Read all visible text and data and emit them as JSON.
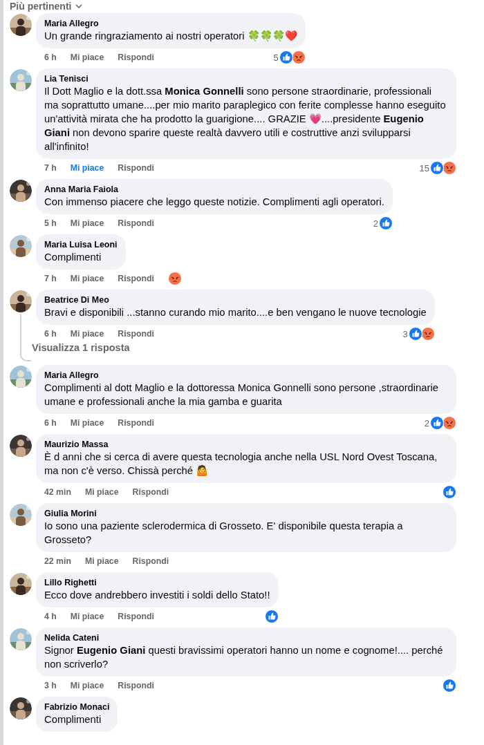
{
  "sort_menu": {
    "label": "Più pertinenti"
  },
  "comments": [
    {
      "author": "Maria Allegro",
      "text": "Un grande ringraziamento ai nostri operatori 🍀🍀🍀❤️",
      "time": "6 h",
      "like_label": "Mi piace",
      "liked": false,
      "reply_label": "Rispondi",
      "reactions": {
        "count": "5",
        "like": true,
        "angry": true
      }
    },
    {
      "author": "Lia Tenisci",
      "text": "Il Dott Maglio e la dott.ssa **Monica Gonnelli** sono persone straordinarie, professionali ma soprattutto umane....per mio marito paraplegico con ferite complesse hanno eseguito un'attività mirata che ha prodotto la guarigione.... GRAZIE 💗....presidente **Eugenio Giani** non devono sparire queste realtà davvero utili e costruttive anzi svilupparsi all'infinito!",
      "time": "7 h",
      "like_label": "Mi piace",
      "liked": true,
      "reply_label": "Rispondi",
      "reactions": {
        "count": "15",
        "like": true,
        "angry": true
      }
    },
    {
      "author": "Anna Maria Faiola",
      "text": "Con immenso piacere che leggo queste notizie. Complimenti agli operatori.",
      "time": "5 h",
      "like_label": "Mi piace",
      "liked": false,
      "reply_label": "Rispondi",
      "reactions": {
        "count": "2",
        "like": true,
        "angry": false
      }
    },
    {
      "author": "Maria Luisa Leoni",
      "text": "Complimenti",
      "time": "7 h",
      "like_label": "Mi piace",
      "liked": false,
      "reply_label": "Rispondi",
      "reactions": {
        "like": false,
        "angry": true
      }
    },
    {
      "author": "Beatrice Di Meo",
      "text": "Bravi e disponibili ...stanno curando mio marito....e ben vengano le nuove tecnologie",
      "time": "6 h",
      "like_label": "Mi piace",
      "liked": false,
      "reply_label": "Rispondi",
      "reactions": {
        "count": "3",
        "like": true,
        "angry": true
      },
      "replies_link": "Visualizza 1 risposta"
    },
    {
      "author": "Maria Allegro",
      "text": "Complimenti al dott Maglio e la dottoressa Monica Gonnelli sono persone ,straordinarie umane e professionali anche la mia gamba e guarita",
      "time": "6 h",
      "like_label": "Mi piace",
      "liked": false,
      "reply_label": "Rispondi",
      "reactions": {
        "count": "2",
        "like": true,
        "angry": true
      }
    },
    {
      "author": "Maurizio Massa",
      "text": "È d anni che si cerca di avere questa tecnologia anche nella USL Nord Ovest Toscana, ma non c'è verso. Chissà perché 🤷",
      "time": "42 min",
      "like_label": "Mi piace",
      "liked": false,
      "reply_label": "Rispondi",
      "reactions": {
        "like": true,
        "angry": false
      }
    },
    {
      "author": "Giulia Morini",
      "text": "Io sono una paziente sclerodermica di Grosseto. E' disponibile questa terapia a Grosseto?",
      "time": "22 min",
      "like_label": "Mi piace",
      "liked": false,
      "reply_label": "Rispondi"
    },
    {
      "author": "Lillo Righetti",
      "text": "Ecco dove andrebbero investiti i soldi dello Stato!!",
      "time": "4 h",
      "like_label": "Mi piace",
      "liked": false,
      "reply_label": "Rispondi",
      "reactions": {
        "like": true,
        "angry": false
      }
    },
    {
      "author": "Nelida Cateni",
      "text": "Signor **Eugenio Giani** questi bravissimi operatori hanno un nome e cognome!.... perché non scriverlo?",
      "time": "3 h",
      "like_label": "Mi piace",
      "liked": false,
      "reply_label": "Rispondi",
      "reactions": {
        "like": true,
        "angry": false
      }
    },
    {
      "author": "Fabrizio Monaci",
      "text": "Complimenti"
    }
  ]
}
